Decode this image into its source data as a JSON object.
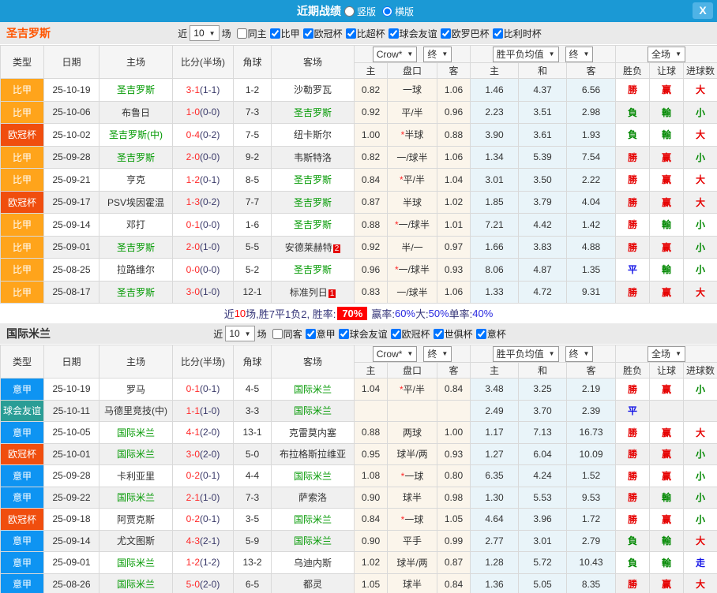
{
  "titlebar": {
    "title": "近期战绩",
    "vertical_label": "竖版",
    "horizontal_label": "横版",
    "close_label": "X",
    "bar_color": "#1B99D5"
  },
  "filter_labels": {
    "near": "近",
    "count": "10",
    "games": "场"
  },
  "table_headers": {
    "main": [
      "类型",
      "日期",
      "主场",
      "比分(半场)",
      "角球",
      "客场"
    ],
    "odds_source_select": "Crow*",
    "final_select": "终",
    "avg_select": "胜平负均值",
    "avg_final_select": "终",
    "scope_select": "全场",
    "sub": [
      "主",
      "盘口",
      "客",
      "主",
      "和",
      "客",
      "胜负",
      "让球",
      "进球数"
    ]
  },
  "league_colors": {
    "比甲": "#FFA41B",
    "欧冠杯": "#F04E0E",
    "意甲": "#0E94F2",
    "球会友谊": "#2A9D96"
  },
  "result_colors": {
    "勝": "r",
    "負": "g",
    "平": "b",
    "赢": "r",
    "輸": "g",
    "大": "r",
    "小": "g",
    "走": "b"
  },
  "sections": [
    {
      "team": "圣吉罗斯",
      "team_color": "#FF5500",
      "same_label": "同主",
      "same_checked": false,
      "leagues": [
        "比甲",
        "欧冠杯",
        "比超杯",
        "球会友谊",
        "欧罗巴杯",
        "比利时杯"
      ],
      "rows": [
        {
          "type": "比甲",
          "date": "25-10-19",
          "home": "圣吉罗斯",
          "home_focus": true,
          "score": "3-1",
          "half": "1-1",
          "corner": "1-2",
          "away": "沙勒罗瓦",
          "h": "0.82",
          "hc": "一球",
          "a": "1.06",
          "m1": "1.46",
          "m2": "4.37",
          "m3": "6.56",
          "r1": "勝",
          "r2": "赢",
          "r3": "大"
        },
        {
          "type": "比甲",
          "date": "25-10-06",
          "home": "布鲁日",
          "score": "1-0",
          "half": "0-0",
          "corner": "7-3",
          "away": "圣吉罗斯",
          "away_focus": true,
          "h": "0.92",
          "hc": "平/半",
          "a": "0.96",
          "m1": "2.23",
          "m2": "3.51",
          "m3": "2.98",
          "r1": "負",
          "r2": "輸",
          "r3": "小"
        },
        {
          "type": "欧冠杯",
          "date": "25-10-02",
          "home": "圣吉罗斯(中)",
          "home_focus": true,
          "score": "0-4",
          "half": "0-2",
          "corner": "7-5",
          "away": "纽卡斯尔",
          "h": "1.00",
          "hc": "*半球",
          "a": "0.88",
          "m1": "3.90",
          "m2": "3.61",
          "m3": "1.93",
          "r1": "負",
          "r2": "輸",
          "r3": "大"
        },
        {
          "type": "比甲",
          "date": "25-09-28",
          "home": "圣吉罗斯",
          "home_focus": true,
          "score": "2-0",
          "half": "0-0",
          "corner": "9-2",
          "away": "韦斯特洛",
          "h": "0.82",
          "hc": "一/球半",
          "a": "1.06",
          "m1": "1.34",
          "m2": "5.39",
          "m3": "7.54",
          "r1": "勝",
          "r2": "赢",
          "r3": "小"
        },
        {
          "type": "比甲",
          "date": "25-09-21",
          "home": "亨克",
          "score": "1-2",
          "half": "0-1",
          "corner": "8-5",
          "away": "圣吉罗斯",
          "away_focus": true,
          "h": "0.84",
          "hc": "*平/半",
          "a": "1.04",
          "m1": "3.01",
          "m2": "3.50",
          "m3": "2.22",
          "r1": "勝",
          "r2": "赢",
          "r3": "大"
        },
        {
          "type": "欧冠杯",
          "date": "25-09-17",
          "home": "PSV埃因霍温",
          "score": "1-3",
          "half": "0-2",
          "corner": "7-7",
          "away": "圣吉罗斯",
          "away_focus": true,
          "h": "0.87",
          "hc": "半球",
          "a": "1.02",
          "m1": "1.85",
          "m2": "3.79",
          "m3": "4.04",
          "r1": "勝",
          "r2": "赢",
          "r3": "大"
        },
        {
          "type": "比甲",
          "date": "25-09-14",
          "home": "邓打",
          "score": "0-1",
          "half": "0-0",
          "corner": "1-6",
          "away": "圣吉罗斯",
          "away_focus": true,
          "h": "0.88",
          "hc": "*一/球半",
          "a": "1.01",
          "m1": "7.21",
          "m2": "4.42",
          "m3": "1.42",
          "r1": "勝",
          "r2": "輸",
          "r3": "小"
        },
        {
          "type": "比甲",
          "date": "25-09-01",
          "home": "圣吉罗斯",
          "home_focus": true,
          "score": "2-0",
          "half": "1-0",
          "corner": "5-5",
          "away": "安德莱赫特",
          "away_badge": "2",
          "h": "0.92",
          "hc": "半/一",
          "a": "0.97",
          "m1": "1.66",
          "m2": "3.83",
          "m3": "4.88",
          "r1": "勝",
          "r2": "赢",
          "r3": "小"
        },
        {
          "type": "比甲",
          "date": "25-08-25",
          "home": "拉路维尔",
          "score": "0-0",
          "half": "0-0",
          "corner": "5-2",
          "away": "圣吉罗斯",
          "away_focus": true,
          "h": "0.96",
          "hc": "*一/球半",
          "a": "0.93",
          "m1": "8.06",
          "m2": "4.87",
          "m3": "1.35",
          "r1": "平",
          "r2": "輸",
          "r3": "小"
        },
        {
          "type": "比甲",
          "date": "25-08-17",
          "home": "圣吉罗斯",
          "home_focus": true,
          "score": "3-0",
          "half": "1-0",
          "corner": "12-1",
          "away": "标准列日",
          "away_badge": "1",
          "h": "0.83",
          "hc": "一/球半",
          "a": "1.06",
          "m1": "1.33",
          "m2": "4.72",
          "m3": "9.31",
          "r1": "勝",
          "r2": "赢",
          "r3": "大"
        }
      ],
      "summary": [
        {
          "t": "近",
          "c": "n"
        },
        {
          "t": "10",
          "c": "r"
        },
        {
          "t": "场,胜7平1负2, 胜率:",
          "c": "n"
        },
        {
          "t": "70%",
          "c": "badge"
        },
        {
          "t": "赢率:",
          "c": "n"
        },
        {
          "t": "60%",
          "c": "b"
        },
        {
          "t": " 大:",
          "c": "n"
        },
        {
          "t": "50%",
          "c": "b"
        },
        {
          "t": " 单率:",
          "c": "n"
        },
        {
          "t": "40%",
          "c": "b"
        }
      ]
    },
    {
      "team": "国际米兰",
      "team_color": "#333333",
      "same_label": "同客",
      "same_checked": false,
      "leagues": [
        "意甲",
        "球会友谊",
        "欧冠杯",
        "世俱杯",
        "意杯"
      ],
      "rows": [
        {
          "type": "意甲",
          "date": "25-10-19",
          "home": "罗马",
          "score": "0-1",
          "half": "0-1",
          "corner": "4-5",
          "away": "国际米兰",
          "away_focus": true,
          "h": "1.04",
          "hc": "*平/半",
          "a": "0.84",
          "m1": "3.48",
          "m2": "3.25",
          "m3": "2.19",
          "r1": "勝",
          "r2": "赢",
          "r3": "小"
        },
        {
          "type": "球会友谊",
          "date": "25-10-11",
          "home": "马德里竞技(中)",
          "score": "1-1",
          "half": "1-0",
          "corner": "3-3",
          "away": "国际米兰",
          "away_focus": true,
          "h": "",
          "hc": "",
          "a": "",
          "m1": "2.49",
          "m2": "3.70",
          "m3": "2.39",
          "r1": "平",
          "r2": "",
          "r3": ""
        },
        {
          "type": "意甲",
          "date": "25-10-05",
          "home": "国际米兰",
          "home_focus": true,
          "score": "4-1",
          "half": "2-0",
          "corner": "13-1",
          "away": "克雷莫内塞",
          "h": "0.88",
          "hc": "两球",
          "a": "1.00",
          "m1": "1.17",
          "m2": "7.13",
          "m3": "16.73",
          "r1": "勝",
          "r2": "赢",
          "r3": "大"
        },
        {
          "type": "欧冠杯",
          "date": "25-10-01",
          "home": "国际米兰",
          "home_focus": true,
          "score": "3-0",
          "half": "2-0",
          "corner": "5-0",
          "away": "布拉格斯拉维亚",
          "h": "0.95",
          "hc": "球半/两",
          "a": "0.93",
          "m1": "1.27",
          "m2": "6.04",
          "m3": "10.09",
          "r1": "勝",
          "r2": "赢",
          "r3": "小"
        },
        {
          "type": "意甲",
          "date": "25-09-28",
          "home": "卡利亚里",
          "score": "0-2",
          "half": "0-1",
          "corner": "4-4",
          "away": "国际米兰",
          "away_focus": true,
          "h": "1.08",
          "hc": "*一球",
          "a": "0.80",
          "m1": "6.35",
          "m2": "4.24",
          "m3": "1.52",
          "r1": "勝",
          "r2": "赢",
          "r3": "小"
        },
        {
          "type": "意甲",
          "date": "25-09-22",
          "home": "国际米兰",
          "home_focus": true,
          "score": "2-1",
          "half": "1-0",
          "corner": "7-3",
          "away": "萨索洛",
          "h": "0.90",
          "hc": "球半",
          "a": "0.98",
          "m1": "1.30",
          "m2": "5.53",
          "m3": "9.53",
          "r1": "勝",
          "r2": "輸",
          "r3": "小"
        },
        {
          "type": "欧冠杯",
          "date": "25-09-18",
          "home": "阿贾克斯",
          "score": "0-2",
          "half": "0-1",
          "corner": "3-5",
          "away": "国际米兰",
          "away_focus": true,
          "h": "0.84",
          "hc": "*一球",
          "a": "1.05",
          "m1": "4.64",
          "m2": "3.96",
          "m3": "1.72",
          "r1": "勝",
          "r2": "赢",
          "r3": "小"
        },
        {
          "type": "意甲",
          "date": "25-09-14",
          "home": "尤文图斯",
          "score": "4-3",
          "half": "2-1",
          "corner": "5-9",
          "away": "国际米兰",
          "away_focus": true,
          "h": "0.90",
          "hc": "平手",
          "a": "0.99",
          "m1": "2.77",
          "m2": "3.01",
          "m3": "2.79",
          "r1": "負",
          "r2": "輸",
          "r3": "大"
        },
        {
          "type": "意甲",
          "date": "25-09-01",
          "home": "国际米兰",
          "home_focus": true,
          "score": "1-2",
          "half": "1-2",
          "corner": "13-2",
          "away": "乌迪内斯",
          "h": "1.02",
          "hc": "球半/两",
          "a": "0.87",
          "m1": "1.28",
          "m2": "5.72",
          "m3": "10.43",
          "r1": "負",
          "r2": "輸",
          "r3": "走"
        },
        {
          "type": "意甲",
          "date": "25-08-26",
          "home": "国际米兰",
          "home_focus": true,
          "score": "5-0",
          "half": "2-0",
          "corner": "6-5",
          "away": "都灵",
          "h": "1.05",
          "hc": "球半",
          "a": "0.84",
          "m1": "1.36",
          "m2": "5.05",
          "m3": "8.35",
          "r1": "勝",
          "r2": "赢",
          "r3": "大"
        }
      ],
      "summary": null
    }
  ]
}
